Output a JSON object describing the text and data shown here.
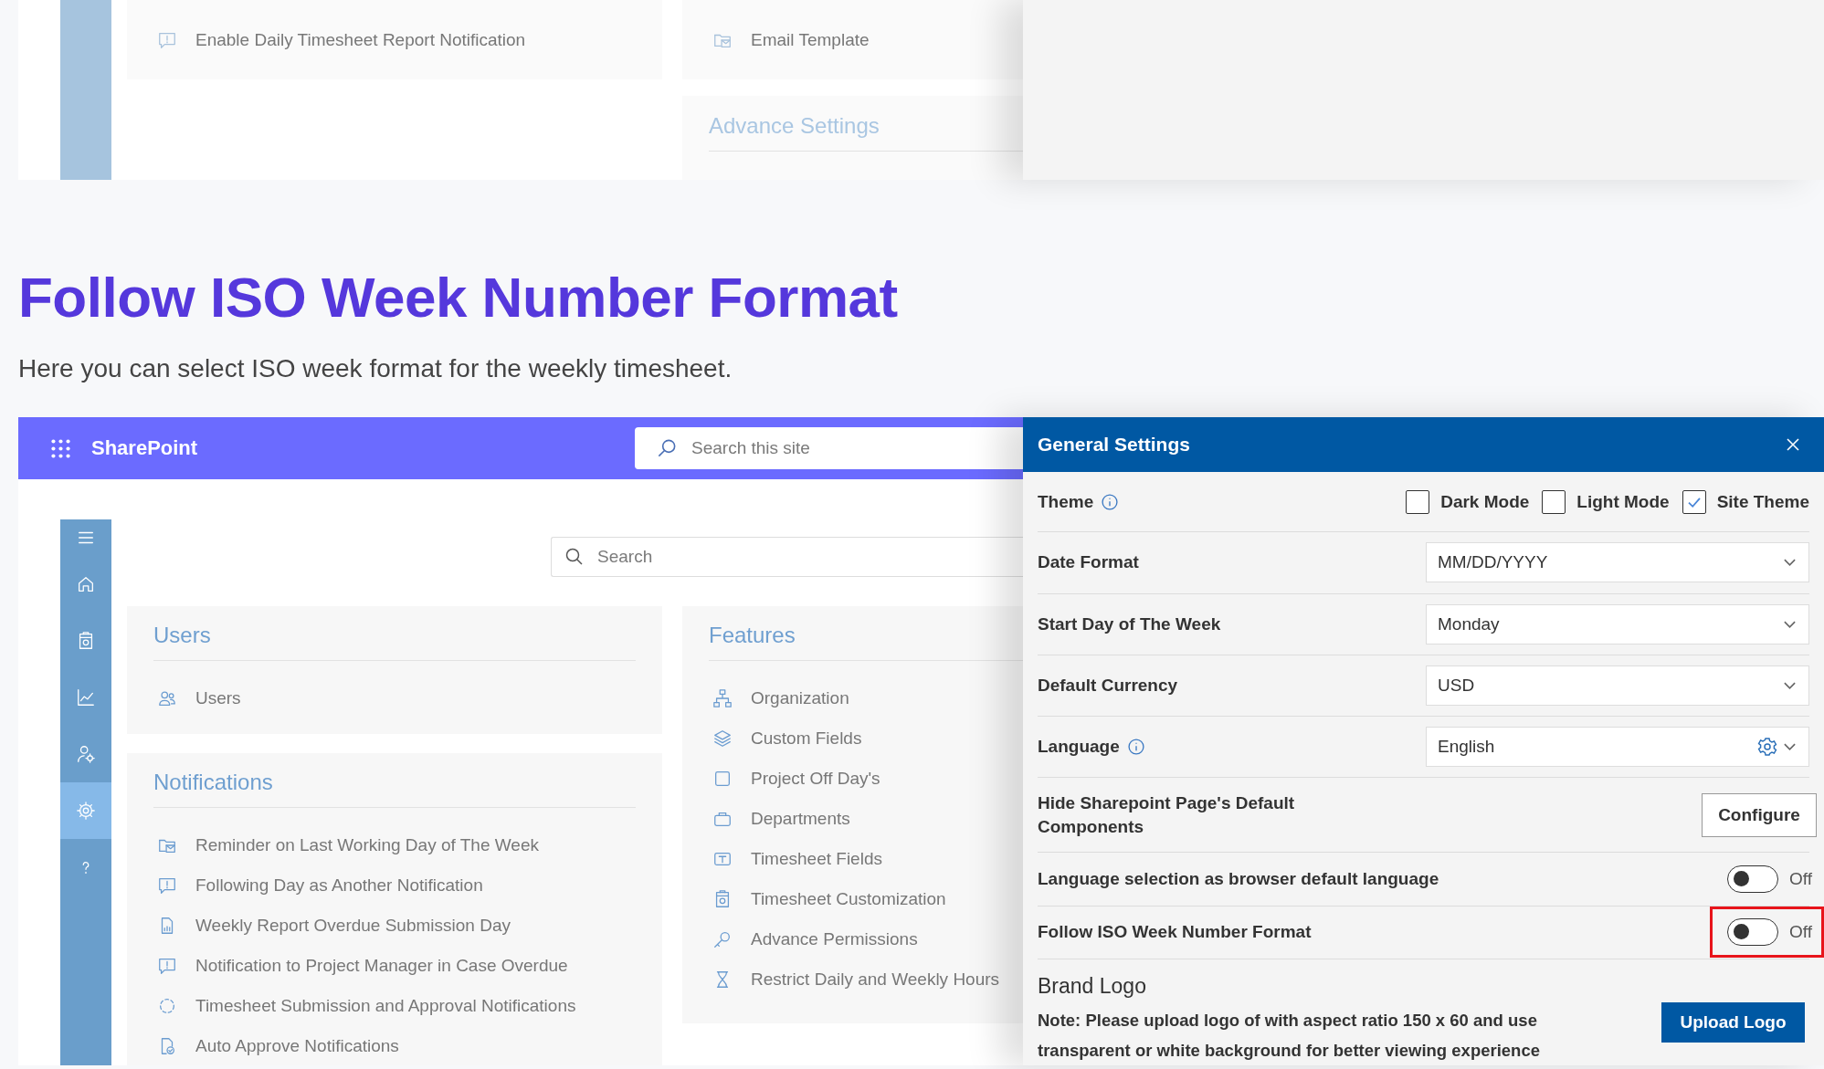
{
  "background_fragment": {
    "notification_items": [
      {
        "kind": "chat-alert",
        "label": "Enable Daily Timesheet Report Notification"
      }
    ],
    "feature_items": [
      {
        "kind": "mail-folder",
        "label": "Email Template"
      }
    ],
    "section_title": "Advance Settings"
  },
  "heading": "Follow ISO Week Number Format",
  "intro": "Here you can select ISO week format for the weekly timesheet.",
  "sharepoint": {
    "app_name": "SharePoint",
    "site_search": {
      "placeholder": "Search this site"
    },
    "sidebar": {
      "items": [
        {
          "kind": "menu",
          "selected": false
        },
        {
          "kind": "home",
          "selected": false
        },
        {
          "kind": "timesheet",
          "selected": false
        },
        {
          "kind": "chart",
          "selected": false
        },
        {
          "kind": "user-gear",
          "selected": false
        },
        {
          "kind": "gear",
          "selected": true
        },
        {
          "kind": "help",
          "selected": false
        }
      ]
    },
    "search": {
      "placeholder": "Search"
    },
    "cards": [
      {
        "title": "Users",
        "items": [
          {
            "kind": "users",
            "label": "Users"
          }
        ]
      },
      {
        "title": "Notifications",
        "items": [
          {
            "kind": "mail-folder",
            "label": "Reminder on Last Working Day of The Week"
          },
          {
            "kind": "chat-alert",
            "label": "Following Day as Another Notification"
          },
          {
            "kind": "report",
            "label": "Weekly Report Overdue Submission Day"
          },
          {
            "kind": "chat-alert",
            "label": "Notification to Project Manager in Case Overdue"
          },
          {
            "kind": "dashed-circle",
            "label": "Timesheet Submission and Approval Notifications"
          },
          {
            "kind": "file-check",
            "label": "Auto Approve Notifications"
          }
        ]
      },
      {
        "title": "Features",
        "items": [
          {
            "kind": "org-chart",
            "label": "Organization"
          },
          {
            "kind": "layers",
            "label": "Custom Fields"
          },
          {
            "kind": "square",
            "label": "Project Off Day's"
          },
          {
            "kind": "briefcase",
            "label": "Departments"
          },
          {
            "kind": "text-field",
            "label": "Timesheet Fields"
          },
          {
            "kind": "timesheet",
            "label": "Timesheet Customization"
          },
          {
            "kind": "key",
            "label": "Advance Permissions"
          },
          {
            "kind": "hourglass",
            "label": "Restrict Daily and Weekly Hours"
          }
        ]
      }
    ]
  },
  "settings_panel": {
    "title": "General Settings",
    "rows": [
      {
        "kind": "checkboxes",
        "label": "Theme",
        "info": true,
        "options": [
          {
            "label": "Dark Mode",
            "checked": false
          },
          {
            "label": "Light Mode",
            "checked": false
          },
          {
            "label": "Site Theme",
            "checked": true
          }
        ]
      },
      {
        "kind": "select",
        "label": "Date Format",
        "value": "MM/DD/YYYY"
      },
      {
        "kind": "select",
        "label": "Start Day of The Week",
        "value": "Monday"
      },
      {
        "kind": "select",
        "label": "Default Currency",
        "value": "USD"
      },
      {
        "kind": "select",
        "label": "Language",
        "info": true,
        "value": "English",
        "gear": true
      },
      {
        "kind": "button",
        "label": "Hide Sharepoint Page's Default Components",
        "button": "Configure"
      },
      {
        "kind": "toggle",
        "label": "Language selection as browser default language",
        "on": false,
        "state_text": "Off",
        "highlighted": false
      },
      {
        "kind": "toggle",
        "label": "Follow ISO Week Number Format",
        "on": false,
        "state_text": "Off",
        "highlighted": true
      }
    ],
    "brand_logo": {
      "title": "Brand Logo",
      "note": "Note: Please upload logo of with aspect ratio 150 x 60 and use transparent or white background for better viewing experience",
      "button": "Upload Logo"
    }
  }
}
